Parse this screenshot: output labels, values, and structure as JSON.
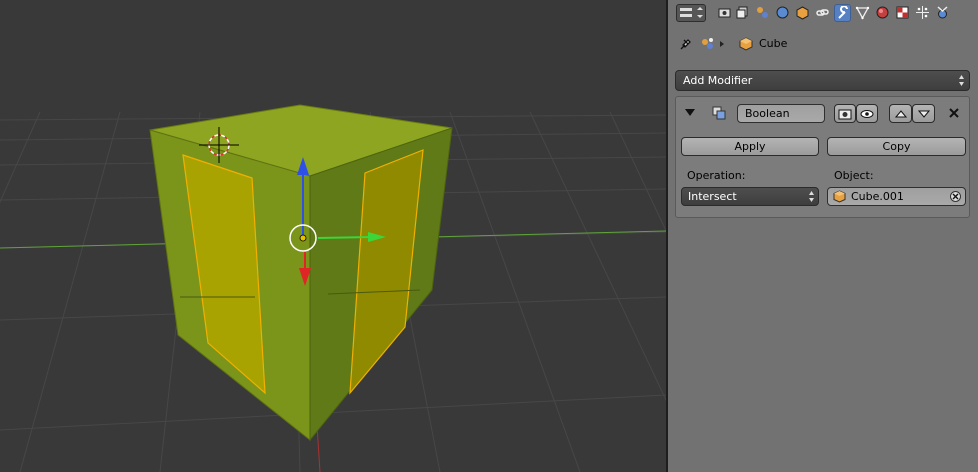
{
  "properties": {
    "context": {
      "object_name": "Cube"
    },
    "add_modifier_label": "Add Modifier",
    "modifier": {
      "name": "Boolean",
      "apply_label": "Apply",
      "copy_label": "Copy",
      "operation_label": "Operation:",
      "operation_value": "Intersect",
      "object_label": "Object:",
      "object_value": "Cube.001"
    },
    "tabs": [
      "render",
      "render-layers",
      "scene",
      "world",
      "object",
      "constraints",
      "modifiers",
      "data",
      "material",
      "texture",
      "particles",
      "physics"
    ],
    "active_tab": "modifiers"
  },
  "viewport": {
    "cube_color": "#7f9a1a",
    "selected_face_color": "#a8a300",
    "x_axis_color": "#e02020",
    "y_axis_color": "#20c020",
    "z_axis_color": "#2040e0"
  }
}
